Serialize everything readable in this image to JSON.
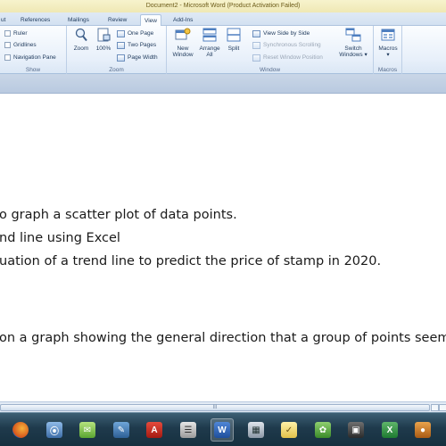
{
  "window": {
    "title": "Document2 - Microsoft Word (Product Activation Failed)"
  },
  "tabs": [
    {
      "label": "ut"
    },
    {
      "label": "References"
    },
    {
      "label": "Mailings"
    },
    {
      "label": "Review"
    },
    {
      "label": "View",
      "active": true
    },
    {
      "label": "Add-Ins"
    }
  ],
  "ribbon": {
    "show": {
      "label": "Show",
      "ruler": "Ruler",
      "gridlines": "Gridlines",
      "navigation_pane": "Navigation Pane"
    },
    "zoom": {
      "label": "Zoom",
      "zoom": "Zoom",
      "hundred": "100%",
      "one_page": "One Page",
      "two_pages": "Two Pages",
      "page_width": "Page Width"
    },
    "window": {
      "label": "Window",
      "new_window": [
        "New",
        "Window"
      ],
      "arrange_all": [
        "Arrange",
        "All"
      ],
      "split": "Split",
      "view_side_by_side": "View Side by Side",
      "synchronous_scrolling": "Synchronous Scrolling",
      "reset_window_position": "Reset Window Position",
      "switch_windows": [
        "Switch",
        "Windows ▾"
      ]
    },
    "macros": {
      "label": "Macros",
      "macros": "Macros",
      "arrow": "▾"
    }
  },
  "document": {
    "lines": [
      "o graph a scatter plot of data points.",
      "nd line using Excel",
      "uation of a trend line to predict the price of stamp in 2020.",
      "on a graph showing the general direction that a group of points seem"
    ]
  },
  "scrollbar": {
    "grip": "III"
  },
  "taskbar": {
    "icons": [
      "firefox",
      "media",
      "chat",
      "gimp",
      "acrobat",
      "finder",
      "word",
      "calculator",
      "notes",
      "paint",
      "camera",
      "excel",
      "app"
    ]
  },
  "colors": {
    "title_bg": "#f4efc4",
    "ribbon_bg": "#dbe7f5",
    "taskbar_bg": "#1f3a4c",
    "text": "#1a1a1a"
  }
}
